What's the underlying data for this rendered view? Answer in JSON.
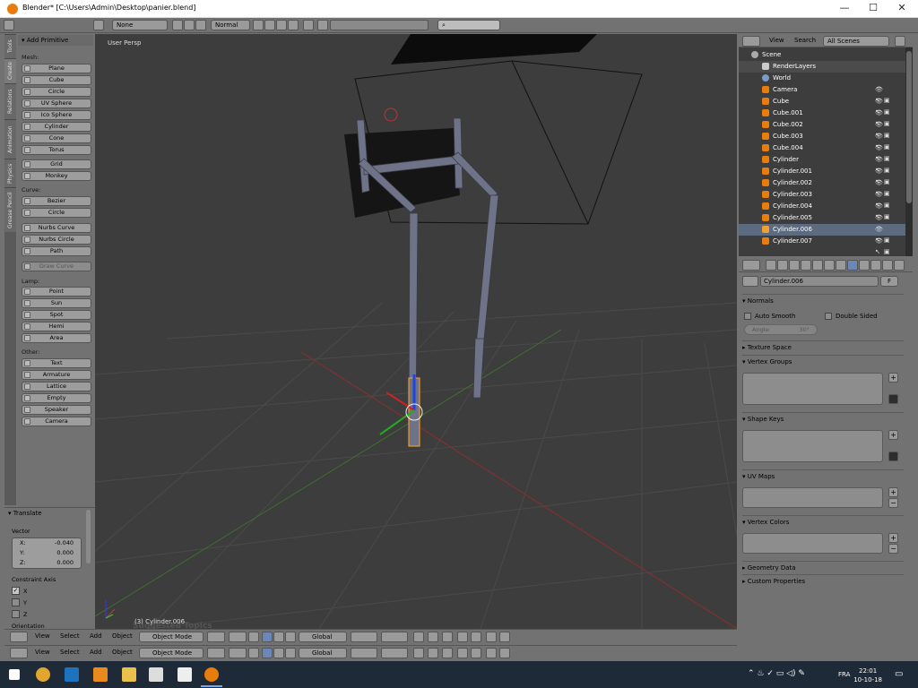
{
  "window": {
    "title": "Blender* [C:\\Users\\Admin\\Desktop\\panier.blend]",
    "controls": [
      "—",
      "☐",
      "✕"
    ]
  },
  "info_header": {
    "render_engine_placeholder": "None",
    "viewport_shading": "Normal"
  },
  "left_tabs": [
    "Tools",
    "Create",
    "Relations",
    "Animation",
    "Physics",
    "Grease Pencil"
  ],
  "tool_shelf": {
    "panel_title": "Add Primitive",
    "mesh_label": "Mesh:",
    "mesh": [
      "Plane",
      "Cube",
      "Circle",
      "UV Sphere",
      "Ico Sphere",
      "Cylinder",
      "Cone",
      "Torus"
    ],
    "mesh2": [
      "Grid",
      "Monkey"
    ],
    "curve_label": "Curve:",
    "curve": [
      "Bezier",
      "Circle"
    ],
    "curve2": [
      "Nurbs Curve",
      "Nurbs Circle",
      "Path"
    ],
    "draw_curve": "Draw Curve",
    "lamp_label": "Lamp:",
    "lamp": [
      "Point",
      "Sun",
      "Spot",
      "Hemi",
      "Area"
    ],
    "other_label": "Other:",
    "other": [
      "Text",
      "Armature",
      "Lattice",
      "Empty",
      "Speaker",
      "Camera"
    ]
  },
  "operator": {
    "title": "Translate",
    "vector_label": "Vector",
    "x_label": "X:",
    "x_value": "-0.040",
    "y_label": "Y:",
    "y_value": "0.000",
    "z_label": "Z:",
    "z_value": "0.000",
    "constraint_label": "Constraint Axis",
    "axes": [
      "X",
      "Y",
      "Z"
    ],
    "axes_checked": [
      true,
      false,
      false
    ],
    "orientation_label": "Orientation"
  },
  "viewport": {
    "view_label": "User Persp",
    "object_label": "(3) Cylinder.006",
    "overlay_hint": "Suggested Topics"
  },
  "header3d": {
    "menus": [
      "View",
      "Select",
      "Add",
      "Object"
    ],
    "mode": "Object Mode",
    "orientation": "Global"
  },
  "outliner": {
    "menus": [
      "View",
      "Search"
    ],
    "scene_select": "All Scenes",
    "rows": [
      {
        "label": "Scene",
        "indent": 0,
        "icon": "scene-icon"
      },
      {
        "label": "RenderLayers",
        "indent": 1,
        "icon": "renderlayers-icon"
      },
      {
        "label": "World",
        "indent": 1,
        "icon": "world-icon"
      },
      {
        "label": "Camera",
        "indent": 1,
        "icon": "camera-icon"
      },
      {
        "label": "Cube",
        "indent": 1,
        "icon": "mesh-icon"
      },
      {
        "label": "Cube.001",
        "indent": 1,
        "icon": "mesh-icon"
      },
      {
        "label": "Cube.002",
        "indent": 1,
        "icon": "mesh-icon"
      },
      {
        "label": "Cube.003",
        "indent": 1,
        "icon": "mesh-icon"
      },
      {
        "label": "Cube.004",
        "indent": 1,
        "icon": "mesh-icon"
      },
      {
        "label": "Cylinder",
        "indent": 1,
        "icon": "mesh-icon"
      },
      {
        "label": "Cylinder.001",
        "indent": 1,
        "icon": "mesh-icon"
      },
      {
        "label": "Cylinder.002",
        "indent": 1,
        "icon": "mesh-icon"
      },
      {
        "label": "Cylinder.003",
        "indent": 1,
        "icon": "mesh-icon"
      },
      {
        "label": "Cylinder.004",
        "indent": 1,
        "icon": "mesh-icon"
      },
      {
        "label": "Cylinder.005",
        "indent": 1,
        "icon": "mesh-icon"
      },
      {
        "label": "Cylinder.006",
        "indent": 1,
        "icon": "mesh-icon",
        "selected": true
      },
      {
        "label": "Cylinder.007",
        "indent": 1,
        "icon": "mesh-icon"
      }
    ]
  },
  "properties": {
    "data_name": "Cylinder.006",
    "fake_user": "F",
    "normals_title": "Normals",
    "auto_smooth": "Auto Smooth",
    "double_sided": "Double Sided",
    "angle_label": "Angle:",
    "angle_value": "30°",
    "texture_space": "Texture Space",
    "vertex_groups": "Vertex Groups",
    "shape_keys": "Shape Keys",
    "uv_maps": "UV Maps",
    "vertex_colors": "Vertex Colors",
    "geometry_data": "Geometry Data",
    "custom_properties": "Custom Properties"
  },
  "taskbar": {
    "language": "FRA",
    "time": "22:01",
    "date": "10-10-18"
  },
  "colors": {
    "accent_orange": "#e87d0d",
    "selected_row": "#5d6b80",
    "viewport_bg": "#3d3d3d"
  }
}
